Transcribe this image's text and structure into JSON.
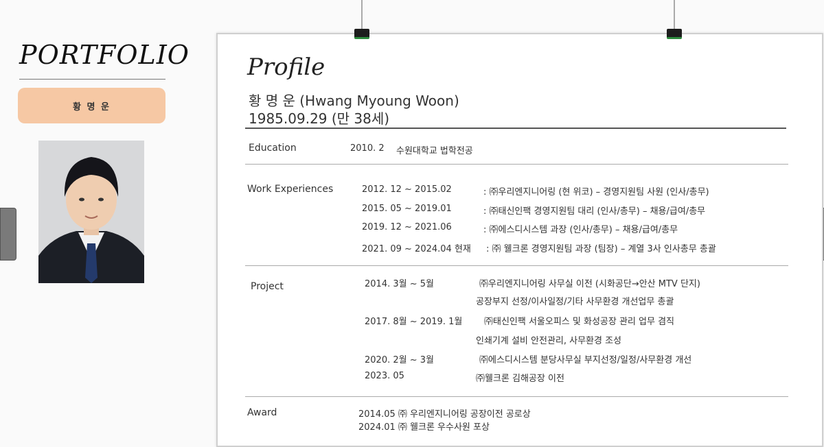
{
  "sidebar": {
    "title": "PORTFOLIO",
    "name": "황 명 운"
  },
  "profile": {
    "heading": "Profile",
    "name": "황 명 운 (Hwang Myoung Woon)",
    "dob": "1985.09.29 (만 38세)"
  },
  "education": {
    "label": "Education",
    "date": "2010. 2",
    "detail": "수원대학교  법학전공"
  },
  "work": {
    "label": "Work Experiences",
    "items": [
      {
        "period": "2012. 12  ~  2015.02",
        "detail": ": ㈜우리엔지니어링 (현 위코) – 경영지원팀 사원 (인사/총무)"
      },
      {
        "period": "2015. 05  ~  2019.01",
        "detail": ": ㈜태신인팩 경영지원팀 대리 (인사/총무) – 채용/급여/총무"
      },
      {
        "period": "2019. 12  ~  2021.06",
        "detail": ": ㈜에스디시스템  과장 (인사/총무) – 채용/급여/총무"
      },
      {
        "period": "2021. 09 ~  2024.04 현재",
        "detail": ": ㈜ 웰크론 경영지원팀 과장 (팀장) – 계열 3사 인사총무 총괄"
      }
    ]
  },
  "project": {
    "label": "Project",
    "items": [
      {
        "period": "2014. 3월  ~  5월",
        "line1": "㈜우리엔지니어링 사무실 이전 (시화공단→안산 MTV 단지)",
        "line2": "공장부지 선정/이사일정/기타 사무환경 개선업무 총괄"
      },
      {
        "period": "2017. 8월  ~  2019. 1월",
        "line1": "㈜태신인팩 서울오피스 및 화성공장 관리 업무 겸직",
        "line2": "인쇄기계 설비 안전관리, 사무환경 조성"
      },
      {
        "period": "2020. 2월  ~  3월",
        "line1": "㈜에스디시스템 분당사무실 부지선정/일정/사무환경 개선",
        "line2": ""
      },
      {
        "period": "2023. 05",
        "line1": "㈜웰크론 김해공장 이전",
        "line2": ""
      }
    ]
  },
  "award": {
    "label": "Award",
    "items": [
      "2014.05  ㈜ 우리엔지니어링 공장이전 공로상",
      "2024.01  ㈜ 웰크론 우수사원 포상"
    ]
  }
}
